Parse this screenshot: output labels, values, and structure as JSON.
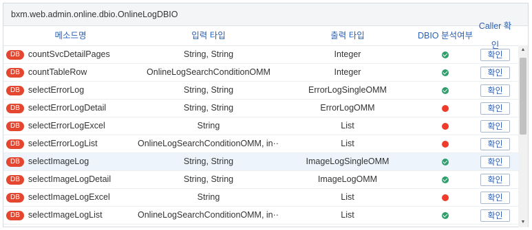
{
  "title": "bxm.web.admin.online.dbio.OnlineLogDBIO",
  "columns": {
    "method": "메소드명",
    "input_type": "입력 타입",
    "output_type": "출력 타입",
    "analysis": "DBIO 분석여부",
    "caller": "Caller 확인"
  },
  "badge_label": "DB",
  "caller_button_label": "확인",
  "status_colors": {
    "ok": "#2e9e6b",
    "error": "#ef3b2c"
  },
  "rows": [
    {
      "method": "countSvcDetailPages",
      "input": "String, String",
      "output": "Integer",
      "status": "ok"
    },
    {
      "method": "countTableRow",
      "input": "OnlineLogSearchConditionOMM",
      "output": "Integer",
      "status": "ok"
    },
    {
      "method": "selectErrorLog",
      "input": "String, String",
      "output": "ErrorLogSingleOMM",
      "status": "ok"
    },
    {
      "method": "selectErrorLogDetail",
      "input": "String, String",
      "output": "ErrorLogOMM",
      "status": "error"
    },
    {
      "method": "selectErrorLogExcel",
      "input": "String",
      "output": "List",
      "status": "error"
    },
    {
      "method": "selectErrorLogList",
      "input": "OnlineLogSearchConditionOMM, in···",
      "output": "List",
      "status": "error"
    },
    {
      "method": "selectImageLog",
      "input": "String, String",
      "output": "ImageLogSingleOMM",
      "status": "ok",
      "selected": true
    },
    {
      "method": "selectImageLogDetail",
      "input": "String, String",
      "output": "ImageLogOMM",
      "status": "ok"
    },
    {
      "method": "selectImageLogExcel",
      "input": "String",
      "output": "List",
      "status": "error"
    },
    {
      "method": "selectImageLogList",
      "input": "OnlineLogSearchConditionOMM, in···",
      "output": "List",
      "status": "ok"
    }
  ]
}
